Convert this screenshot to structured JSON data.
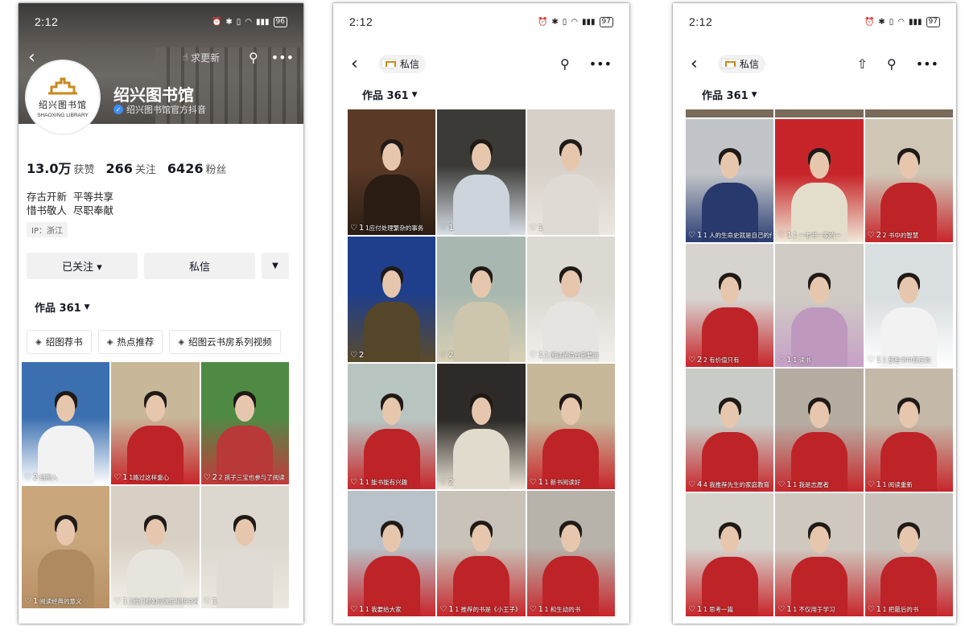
{
  "status_bar": [
    {
      "time": "2:12",
      "battery": "96"
    },
    {
      "time": "2:12",
      "battery": "97"
    },
    {
      "time": "2:12",
      "battery": "97"
    }
  ],
  "profile": {
    "update_label": "求更新",
    "name": "绍兴图书馆",
    "verified_text": "绍兴图书馆官方抖音",
    "logo_cn": "绍兴图书馆",
    "logo_en": "SHAOXING LIBRARY",
    "stats": [
      {
        "value": "13.0万",
        "label": "获赞"
      },
      {
        "value": "266",
        "label": "关注"
      },
      {
        "value": "6426",
        "label": "粉丝"
      }
    ],
    "bio": "存古开新  平等共享\n惜书敬人  尽职奉献",
    "ip": "IP：浙江",
    "follow_button": "已关注 ▾",
    "message_button": "私信",
    "works_label": "作品 361",
    "tags": [
      "绍图荐书",
      "热点推荐",
      "绍图云书房系列视频"
    ]
  },
  "nav": {
    "message_chip": "私信",
    "works_label": "作品 361"
  },
  "grid1": [
    {
      "likes": "2",
      "caption": "绍图入",
      "top": "#3b6fb0",
      "bottom": "#ffffff"
    },
    {
      "likes": "1",
      "caption": "1路过这样重心",
      "top": "#c9b79a",
      "bottom": "#c8252a"
    },
    {
      "likes": "2",
      "caption": "2 孩子三宝也参与了阅读",
      "top": "#4f8a45",
      "bottom": "#c33b3b"
    },
    {
      "likes": "1",
      "caption": "阅读经典的意义",
      "top": "#c9a67c",
      "bottom": "#b89064"
    },
    {
      "likes": "1",
      "caption": "1我们都如何做正常研究等",
      "top": "#d8d0c4",
      "bottom": "#f3f0ea"
    },
    {
      "likes": "1",
      "caption": "",
      "top": "#dcd7cf",
      "bottom": "#ece8e0"
    }
  ],
  "grid2": [
    {
      "likes": "1",
      "caption": "1应付处理繁杂的事务",
      "top": "#5a3a26",
      "bottom": "#2c1d14"
    },
    {
      "likes": "1",
      "caption": "",
      "top": "#3b3a36",
      "bottom": "#d8dfe6"
    },
    {
      "likes": "1",
      "caption": "",
      "top": "#d6d0c8",
      "bottom": "#ebe6df"
    },
    {
      "likes": "2",
      "caption": "",
      "top": "#1f3f8c",
      "bottom": "#5a4a2b"
    },
    {
      "likes": "2",
      "caption": "",
      "top": "#a8b8b0",
      "bottom": "#d9d0b5"
    },
    {
      "likes": "1",
      "caption": "1 阅读是适合需要的",
      "top": "#dcd8d2",
      "bottom": "#f2f0ec"
    },
    {
      "likes": "1",
      "caption": "1 能书能有兴趣",
      "top": "#b8c4c0",
      "bottom": "#c8252a"
    },
    {
      "likes": "2",
      "caption": "",
      "top": "#2e2a27",
      "bottom": "#ece6d8"
    },
    {
      "likes": "1",
      "caption": "1 新书阅读好",
      "top": "#c7b89a",
      "bottom": "#c8252a"
    },
    {
      "likes": "1",
      "caption": "1 我要给大家",
      "top": "#b9c2c8",
      "bottom": "#c8252a"
    },
    {
      "likes": "1",
      "caption": "1 推荐的书是《小王子》",
      "top": "#c8c2b8",
      "bottom": "#c8252a"
    },
    {
      "likes": "1",
      "caption": "1 和生动的书",
      "top": "#b7b3ab",
      "bottom": "#c8252a"
    }
  ],
  "grid3": [
    {
      "likes": "1",
      "caption": "1 人的生命史就是自己的作",
      "top": "#c1c4c8",
      "bottom": "#2a3d73"
    },
    {
      "likes": "1",
      "caption": "1 一本书一家的一",
      "top": "#c8252a",
      "bottom": "#efe9d6"
    },
    {
      "likes": "2",
      "caption": "2 书中的智慧",
      "top": "#cfc6b6",
      "bottom": "#c8252a"
    },
    {
      "likes": "2",
      "caption": "2 有价值只有",
      "top": "#d7d4d0",
      "bottom": "#c8252a"
    },
    {
      "likes": "1",
      "caption": "1 读书",
      "top": "#cfcac4",
      "bottom": "#c8a0c8"
    },
    {
      "likes": "1",
      "caption": "1 那些书中真正的",
      "top": "#d9dee0",
      "bottom": "#ffffff"
    },
    {
      "likes": "4",
      "caption": "4 我推荐先生的家庭教育",
      "top": "#c9ccc6",
      "bottom": "#c8252a"
    },
    {
      "likes": "1",
      "caption": "1 我是志愿者",
      "top": "#b6ada2",
      "bottom": "#c8252a"
    },
    {
      "likes": "1",
      "caption": "1 阅读重新",
      "top": "#c4b8a8",
      "bottom": "#c8252a"
    },
    {
      "likes": "1",
      "caption": "1 思考一篇",
      "top": "#d6d2cc",
      "bottom": "#c8252a"
    },
    {
      "likes": "1",
      "caption": "1 不仅用于学习",
      "top": "#cfc8bf",
      "bottom": "#c8252a"
    },
    {
      "likes": "1",
      "caption": "1 把最后的书",
      "top": "#c9c3bc",
      "bottom": "#c8252a"
    }
  ]
}
